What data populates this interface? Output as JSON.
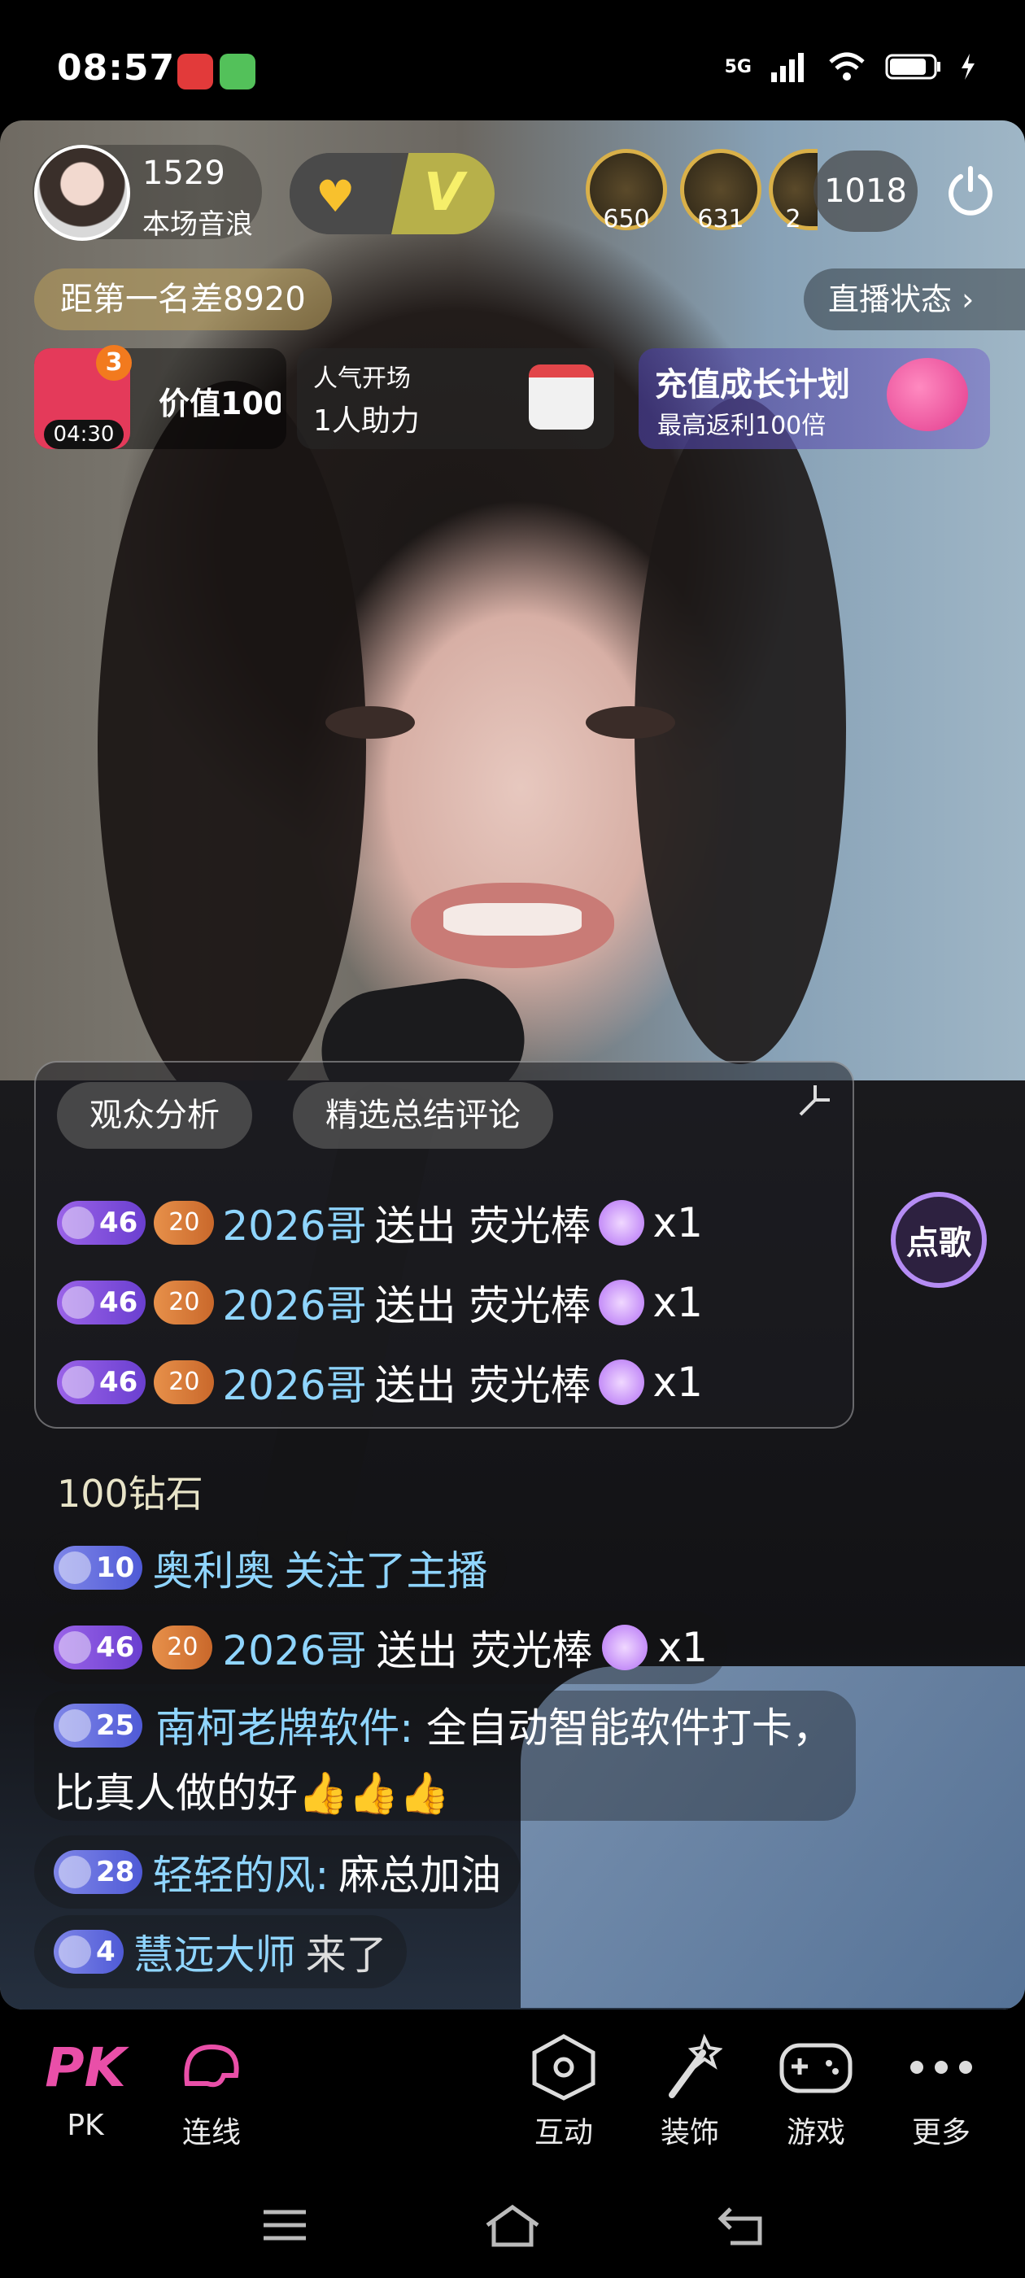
{
  "status_bar": {
    "time": "08:57",
    "network": "5G"
  },
  "host": {
    "count": "1529",
    "subtitle": "本场音浪"
  },
  "top_rank": [
    {
      "value": "650"
    },
    {
      "value": "631"
    },
    {
      "value": "2"
    }
  ],
  "viewer_count": "1018",
  "rank_gap": "距第一名差8920",
  "live_status": "直播状态 ›",
  "gift_card": {
    "badge": "3",
    "timer": "04:30",
    "value": "价值100"
  },
  "popularity": {
    "title": "人气开场",
    "subtitle": "1人助力"
  },
  "recharge": {
    "title": "充值成长计划",
    "subtitle": "最高返利100倍"
  },
  "panel_tabs": [
    "观众分析",
    "精选总结评论"
  ],
  "song_button": "点歌",
  "gift_messages": [
    {
      "level": "46",
      "fan": "20",
      "user": "2026哥",
      "text": "送出 荧光棒",
      "count": "x1"
    },
    {
      "level": "46",
      "fan": "20",
      "user": "2026哥",
      "text": "送出 荧光棒",
      "count": "x1"
    },
    {
      "level": "46",
      "fan": "20",
      "user": "2026哥",
      "text": "送出 荧光棒",
      "count": "x1"
    }
  ],
  "diamond_text": "100钻石",
  "chat": [
    {
      "level": "10",
      "user": "奥利奥",
      "text": "关注了主播"
    },
    {
      "level": "46",
      "fan": "20",
      "user": "2026哥",
      "text": "送出 荧光棒",
      "count": "x1"
    },
    {
      "level": "25",
      "user": "南柯老牌软件:",
      "text": "全自动智能软件打卡，比真人做的好👍👍👍"
    },
    {
      "level": "28",
      "user": "轻轻的风:",
      "text": "麻总加油"
    },
    {
      "level": "4",
      "user": "慧远大师",
      "text": "来了"
    }
  ],
  "bottom_nav": [
    {
      "label": "PK"
    },
    {
      "label": "连线"
    },
    {
      "label": "互动"
    },
    {
      "label": "装饰"
    },
    {
      "label": "游戏"
    },
    {
      "label": "更多"
    }
  ]
}
